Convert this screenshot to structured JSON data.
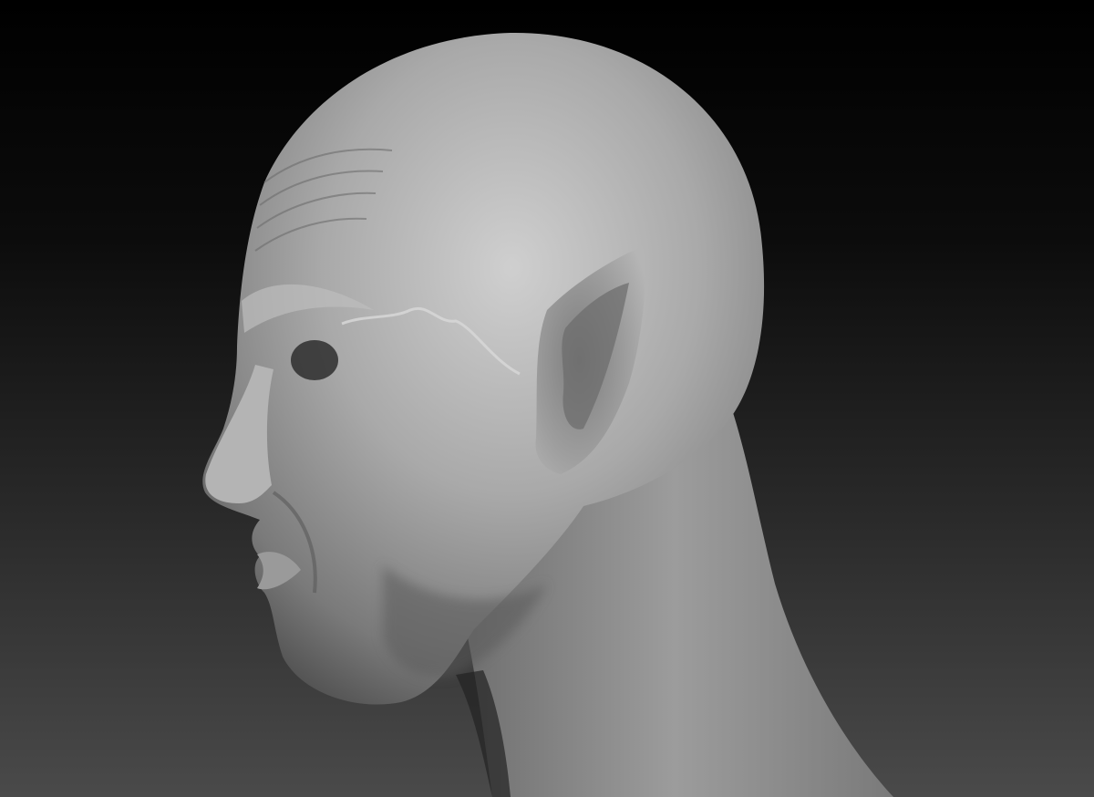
{
  "scene": {
    "subject": "sculpted-elf-head-profile",
    "material": "matte-gray-clay",
    "facing": "left",
    "colors": {
      "background_top": "#000000",
      "background_bottom": "#4a4a4a",
      "clay_light": "#c9c9c9",
      "clay_mid": "#8f8f8f",
      "clay_dark": "#3a3a3a"
    }
  }
}
